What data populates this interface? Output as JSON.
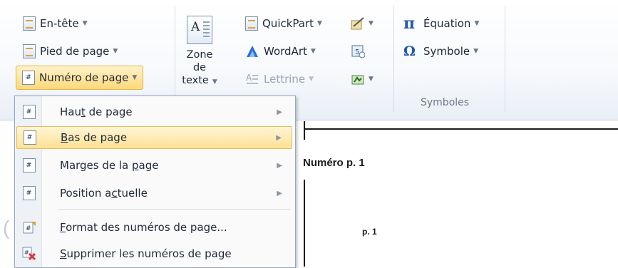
{
  "ribbon": {
    "header_footer": {
      "header": "En-tête",
      "footer": "Pied de page",
      "page_number": "Numéro de page"
    },
    "text_group": {
      "text_box_line1": "Zone de",
      "text_box_line2": "texte",
      "quickpart": "QuickPart",
      "wordart": "WordArt",
      "dropcap": "Lettrine",
      "text_box_icon_letter": "A"
    },
    "symbols_group": {
      "equation": "Équation",
      "symbol": "Symbole",
      "group_label": "Symboles"
    }
  },
  "page_number_menu": {
    "items": [
      {
        "pre": "Hau",
        "key": "t",
        "post": " de page",
        "submenu": true,
        "icon": "page-top-icon"
      },
      {
        "pre": "",
        "key": "B",
        "post": "as de page",
        "submenu": true,
        "icon": "page-bottom-icon",
        "highlighted": true
      },
      {
        "pre": "Marges de la ",
        "key": "p",
        "post": "age",
        "submenu": true,
        "icon": "page-margins-icon"
      },
      {
        "pre": "Position a",
        "key": "c",
        "post": "tuelle",
        "submenu": true,
        "icon": "current-position-icon"
      },
      {
        "pre": "",
        "key": "F",
        "post": "ormat des numéros de page...",
        "submenu": false,
        "icon": "format-page-numbers-icon"
      },
      {
        "pre": "",
        "key": "S",
        "post": "upprimer les numéros de page",
        "submenu": false,
        "icon": "remove-page-numbers-icon"
      }
    ]
  },
  "document": {
    "label_main": "Numéro p. 1",
    "label_small": "p. 1",
    "partial_glyph": "("
  },
  "colors": {
    "highlight": "#ffe194",
    "accent": "#2458a6"
  }
}
